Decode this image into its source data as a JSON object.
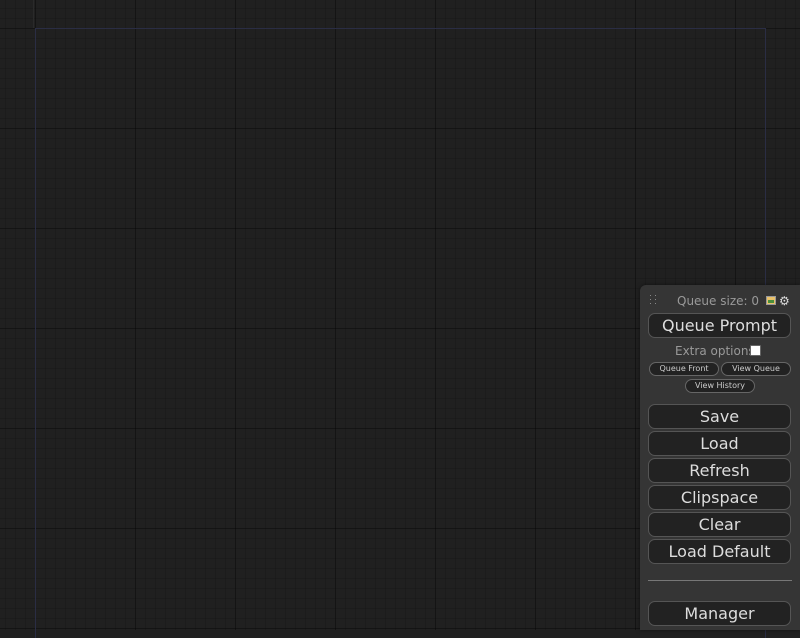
{
  "queue": {
    "size_label": "Queue size: 0",
    "image_icon": "image-icon",
    "settings_icon": "gear-icon"
  },
  "buttons": {
    "queue_prompt": "Queue Prompt",
    "extra_options_label": "Extra options",
    "queue_front": "Queue Front",
    "view_queue": "View Queue",
    "view_history": "View History",
    "save": "Save",
    "load": "Load",
    "refresh": "Refresh",
    "clipspace": "Clipspace",
    "clear": "Clear",
    "load_default": "Load Default",
    "manager": "Manager"
  },
  "extra_options_checked": false,
  "colors": {
    "canvas_bg": "#202020",
    "menu_bg": "#353535",
    "button_bg": "#222222",
    "button_text": "#dddddd",
    "group_border": "#2a2d44"
  }
}
